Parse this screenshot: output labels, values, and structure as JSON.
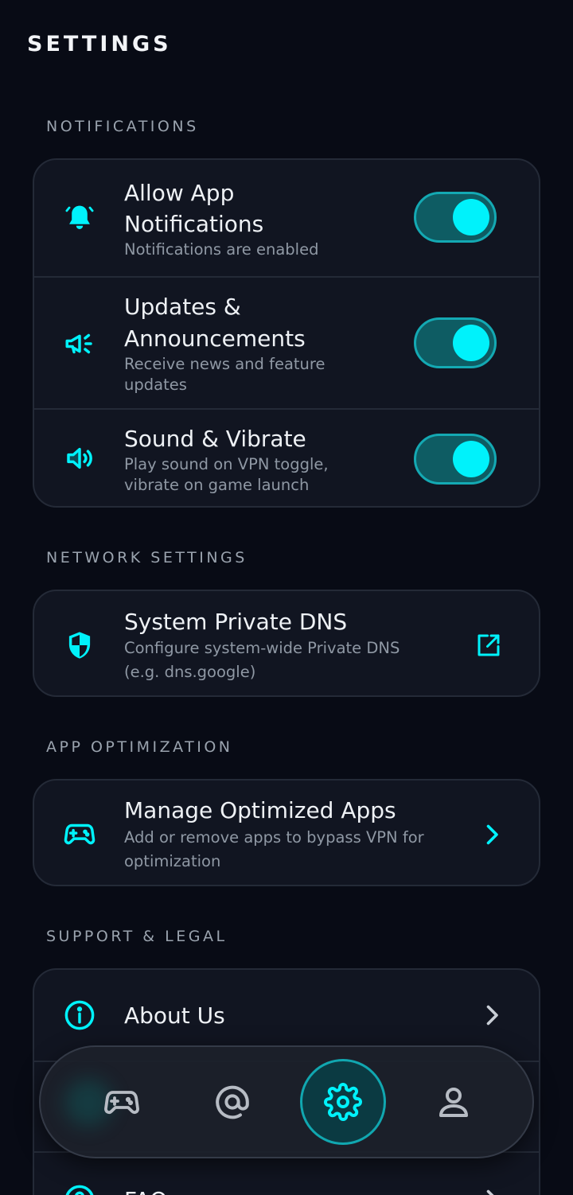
{
  "page": {
    "title": "SETTINGS"
  },
  "colors": {
    "accent": "#00f2fb",
    "background": "#080b15",
    "card": "#111521",
    "toggle_track": "#0e5c63"
  },
  "sections": {
    "notifications": {
      "label": "NOTIFICATIONS",
      "items": [
        {
          "title_line1": "Allow App",
          "title_line2": "Notifications",
          "subtitle": "Notifications are enabled",
          "icon": "bell-icon",
          "toggle_on": true
        },
        {
          "title_line1": "Updates &",
          "title_line2": "Announcements",
          "subtitle_line1": "Receive news and feature",
          "subtitle_line2": "updates",
          "icon": "megaphone-icon",
          "toggle_on": true
        },
        {
          "title": "Sound & Vibrate",
          "subtitle_line1": "Play sound on VPN toggle,",
          "subtitle_line2": "vibrate on game launch",
          "icon": "speaker-icon",
          "toggle_on": true
        }
      ]
    },
    "network": {
      "label": "NETWORK SETTINGS",
      "items": [
        {
          "title": "System Private DNS",
          "subtitle_line1": "Configure system-wide Private DNS",
          "subtitle_line2": "(e.g. dns.google)",
          "icon": "shield-icon",
          "trailing": "external-link-icon"
        }
      ]
    },
    "optimization": {
      "label": "APP OPTIMIZATION",
      "items": [
        {
          "title": "Manage Optimized Apps",
          "subtitle_line1": "Add or remove apps to bypass VPN for",
          "subtitle_line2": "optimization",
          "icon": "gamepad-icon",
          "trailing": "chevron-right-icon"
        }
      ]
    },
    "support": {
      "label": "SUPPORT & LEGAL",
      "items": [
        {
          "title": "About Us",
          "icon": "info-icon",
          "trailing": "chevron-right-icon"
        },
        {
          "title": "FAQ",
          "icon": "help-icon",
          "trailing": "chevron-right-icon"
        }
      ]
    }
  },
  "bottom_nav": {
    "items": [
      {
        "name": "games",
        "icon": "gamepad-icon",
        "active": false
      },
      {
        "name": "at",
        "icon": "at-icon",
        "active": false
      },
      {
        "name": "settings",
        "icon": "gear-icon",
        "active": true
      },
      {
        "name": "profile",
        "icon": "user-icon",
        "active": false
      }
    ]
  }
}
